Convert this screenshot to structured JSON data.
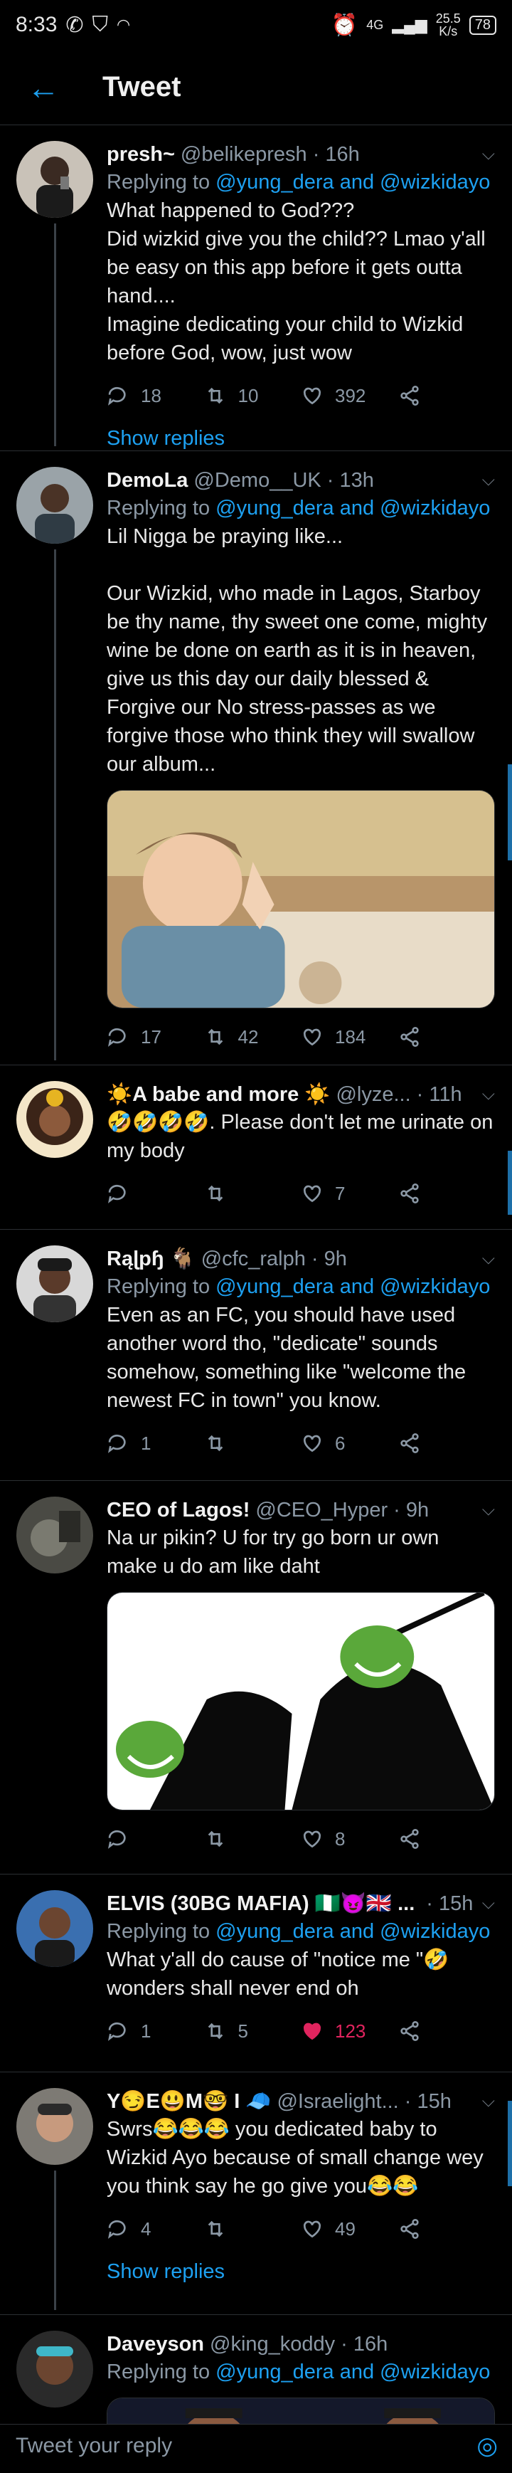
{
  "status": {
    "time": "8:33",
    "net_top": "4G",
    "speed_top": "25.5",
    "speed_unit": "K/s",
    "battery": "78"
  },
  "header": {
    "title": "Tweet"
  },
  "tweets": [
    {
      "name": "presh~",
      "handle": "@belikepresh",
      "time": "· 16h",
      "reply_prefix": "Replying to",
      "mention1": "@yung_dera",
      "and": "and",
      "mention2": "@wizkidayo",
      "text": "What happened to God???\nDid wizkid give you the child?? Lmao y'all be easy on this app before it gets outta hand....\nImagine dedicating your child to Wizkid before God, wow, just wow",
      "replies": "18",
      "retweets": "10",
      "likes": "392",
      "show_replies": "Show replies"
    },
    {
      "name": "DemoLa",
      "handle": "@Demo__UK",
      "time": "· 13h",
      "reply_prefix": "Replying to",
      "mention1": "@yung_dera",
      "and": "and",
      "mention2": "@wizkidayo",
      "text": "Lil Nigga be praying like...\n\nOur Wizkid, who made in Lagos, Starboy be thy name, thy sweet one come, mighty wine be done on earth as it is in heaven, give us this day our daily blessed & Forgive our No stress-passes as we forgive those who think they will swallow our album...",
      "replies": "17",
      "retweets": "42",
      "likes": "184"
    },
    {
      "name": "☀️A babe and more ☀️",
      "handle": "@lyze...",
      "time": "· 11h",
      "text": "🤣🤣🤣🤣. Please don't let me urinate on my body",
      "replies": "",
      "retweets": "",
      "likes": "7"
    },
    {
      "name": "Rąɭpɧ 🐐",
      "handle": "@cfc_ralph",
      "time": "· 9h",
      "reply_prefix": "Replying to",
      "mention1": "@yung_dera",
      "and": "and",
      "mention2": "@wizkidayo",
      "text": "Even as an FC, you should have used another word tho, \"dedicate\" sounds somehow, something like \"welcome the newest FC in town\" you know.",
      "replies": "1",
      "retweets": "",
      "likes": "6"
    },
    {
      "name": "CEO of Lagos!",
      "handle": "@CEO_Hyper",
      "time": "· 9h",
      "text": "Na ur pikin? U for try go born ur own make u do am like daht",
      "replies": "",
      "retweets": "",
      "likes": "8"
    },
    {
      "name": "ELVIS (30BG MAFIA) 🇳🇬😈🇬🇧 ...",
      "handle": "",
      "time": "· 15h",
      "reply_prefix": "Replying to",
      "mention1": "@yung_dera",
      "and": "and",
      "mention2": "@wizkidayo",
      "text": "What y'all do cause of \"notice me \"🤣 wonders shall never end oh",
      "replies": "1",
      "retweets": "5",
      "likes": "123"
    },
    {
      "name": "Y😏E😃M🤓 I 🧢",
      "handle": "@Israelight...",
      "time": "· 15h",
      "text": "Swrs😂😂😂 you dedicated baby to Wizkid Ayo because of small change wey you think say he go give you😂😂",
      "replies": "4",
      "retweets": "",
      "likes": "49",
      "show_replies": "Show replies"
    },
    {
      "name": "Daveyson",
      "handle": "@king_koddy",
      "time": "· 16h",
      "reply_prefix": "Replying to",
      "mention1": "@yung_dera",
      "and": "and",
      "mention2": "@wizkidayo",
      "text": ""
    }
  ],
  "composer": {
    "placeholder": "Tweet your reply"
  },
  "colors": {
    "accent": "#1da1f2",
    "like": "#e0245e",
    "bg": "#000000"
  }
}
